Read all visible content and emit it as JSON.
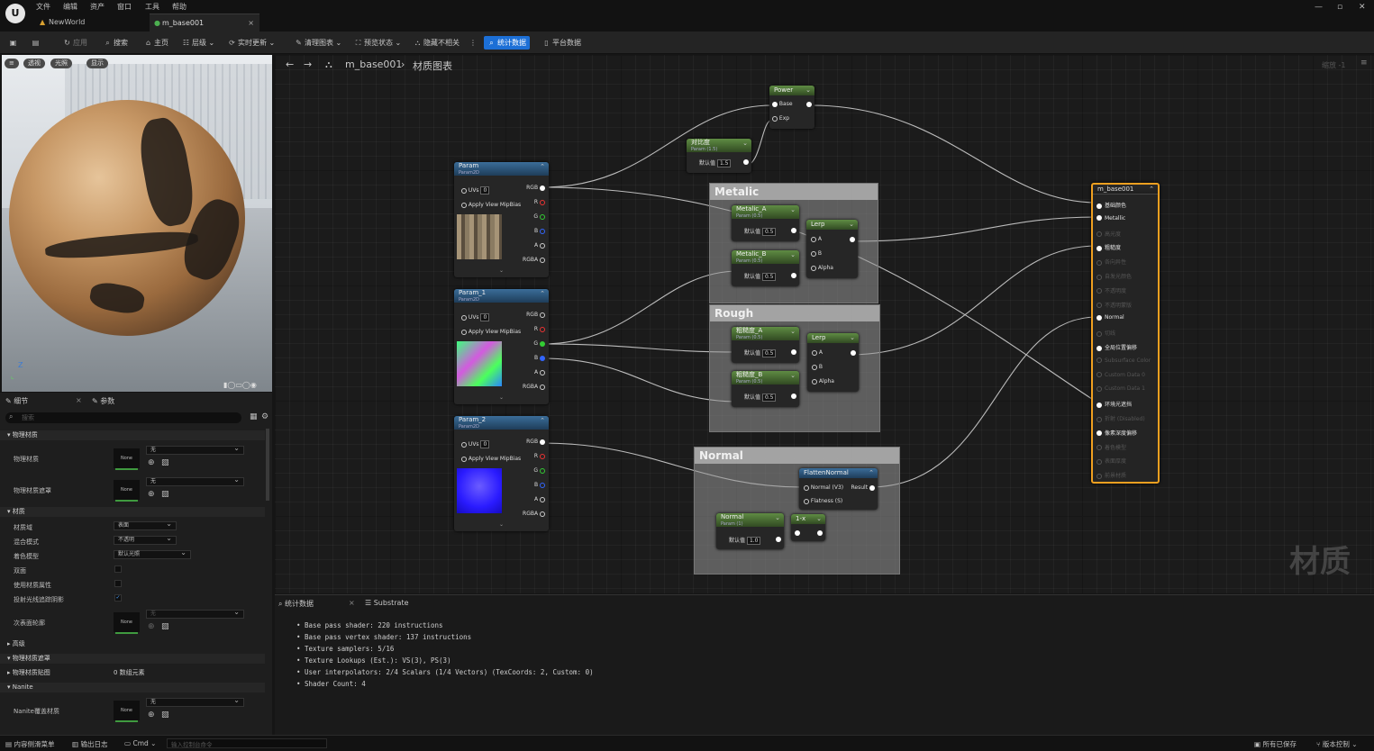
{
  "menu": {
    "logo": "U",
    "items": [
      "文件",
      "编辑",
      "资产",
      "窗口",
      "工具",
      "帮助"
    ]
  },
  "tabs": [
    {
      "label": "NewWorld",
      "active": false
    },
    {
      "label": "m_base001",
      "active": true
    }
  ],
  "toolbar": {
    "apply": "应用",
    "search": "搜索",
    "home": "主页",
    "hierarchy": "层级",
    "live_update": "实时更新",
    "clean_graph": "清理图表",
    "preview_state": "预览状态",
    "hide_unrelated": "隐藏不相关",
    "stats": "统计数据",
    "platform_stats": "平台数据"
  },
  "viewport": {
    "buttons": [
      "透视",
      "光照",
      "显示"
    ],
    "axis_label": "Z"
  },
  "details": {
    "tabs": [
      "细节",
      "参数"
    ],
    "search_placeholder": "搜索",
    "sections": {
      "physical_material": "物理材质",
      "material": "材质",
      "advanced": "高级",
      "physical_material_mask": "物理材质遮罩",
      "physical_material_map": "物理材质贴图",
      "nanite": "Nanite"
    },
    "rows": {
      "phys_mat": "物理材质",
      "phys_mat_mask": "物理材质遮罩",
      "material_domain": "材质域",
      "blend_mode": "混合模式",
      "shading_model": "着色模型",
      "two_sided": "双面",
      "use_material_attributes": "使用材质属性",
      "cast_ray_shadows": "投射光线追踪阴影",
      "subsurface_profile": "次表面轮廓",
      "phys_map_value": "0 数组元素",
      "nanite_override": "Nanite覆盖材质"
    },
    "values": {
      "none": "None",
      "wu": "无",
      "surface": "表面",
      "opaque": "不透明",
      "default_lit": "默认光照"
    }
  },
  "graph": {
    "breadcrumb": {
      "asset": "m_base001",
      "sep": "›",
      "page": "材质图表"
    },
    "zoom": "缩放 -1",
    "watermark": "材质",
    "comments": {
      "metalic": "Metalic",
      "rough": "Rough",
      "normal": "Normal"
    },
    "nodes": {
      "power": {
        "title": "Power",
        "pins": [
          "Base",
          "Exp"
        ]
      },
      "contrast": {
        "title": "对比度",
        "sub": "Param (1.5)",
        "label": "默认值",
        "value": "1.5"
      },
      "param": {
        "title": "Param",
        "sub": "Param2D"
      },
      "param1": {
        "title": "Param_1",
        "sub": "Param2D"
      },
      "param2": {
        "title": "Param_2",
        "sub": "Param2D"
      },
      "tex_pins": {
        "uvs": "UVs",
        "uvs_val": "0",
        "mip": "Apply View MipBias",
        "out": [
          "RGB",
          "R",
          "G",
          "B",
          "A",
          "RGBA"
        ]
      },
      "metalic_a": {
        "title": "Metalic_A",
        "sub": "Param (0.5)",
        "label": "默认值",
        "value": "0.5"
      },
      "metalic_b": {
        "title": "Metalic_B",
        "sub": "Param (0.5)",
        "label": "默认值",
        "value": "0.5"
      },
      "rough_a": {
        "title": "粗糙度_A",
        "sub": "Param (0.5)",
        "label": "默认值",
        "value": "0.5"
      },
      "rough_b": {
        "title": "粗糙度_B",
        "sub": "Param (0.5)",
        "label": "默认值",
        "value": "0.5"
      },
      "lerp": {
        "title": "Lerp",
        "pins": [
          "A",
          "B",
          "Alpha"
        ]
      },
      "flatten": {
        "title": "FlattenNormal",
        "in1": "Normal (V3)",
        "out": "Result",
        "in2": "Flatness (S)"
      },
      "normal_p": {
        "title": "Normal",
        "sub": "Param (1)",
        "label": "默认值",
        "value": "1.0"
      },
      "one_minus": {
        "title": "1-x"
      },
      "result": {
        "title": "m_base001",
        "pins": [
          "基础颜色",
          "Metallic",
          "高光度",
          "粗糙度",
          "各向异性",
          "自发光颜色",
          "不透明度",
          "不透明蒙版",
          "Normal",
          "切线",
          "全局位置偏移",
          "Subsurface Color",
          "Custom Data 0",
          "Custom Data 1",
          "环境光遮挡",
          "折射 (Disabled)",
          "像素深度偏移",
          "着色模型",
          "表面厚度",
          "前景材质"
        ],
        "active": [
          true,
          true,
          false,
          true,
          false,
          false,
          false,
          false,
          true,
          false,
          true,
          false,
          false,
          false,
          true,
          false,
          true,
          false,
          false,
          false
        ]
      }
    }
  },
  "stats": {
    "tabs": [
      "统计数据",
      "Substrate"
    ],
    "lines": [
      "Base pass shader: 220 instructions",
      "Base pass vertex shader: 137 instructions",
      "Texture samplers: 5/16",
      "Texture Lookups (Est.): VS(3), PS(3)",
      "User interpolators: 2/4 Scalars (1/4 Vectors) (TexCoords: 2, Custom: 0)",
      "Shader Count: 4"
    ]
  },
  "statusbar": {
    "content_drawer": "内容侧滑菜单",
    "output_log": "输出日志",
    "cmd": "Cmd",
    "console_placeholder": "输入控制台命令",
    "all_saved": "所有已保存",
    "source_control": "版本控制"
  }
}
